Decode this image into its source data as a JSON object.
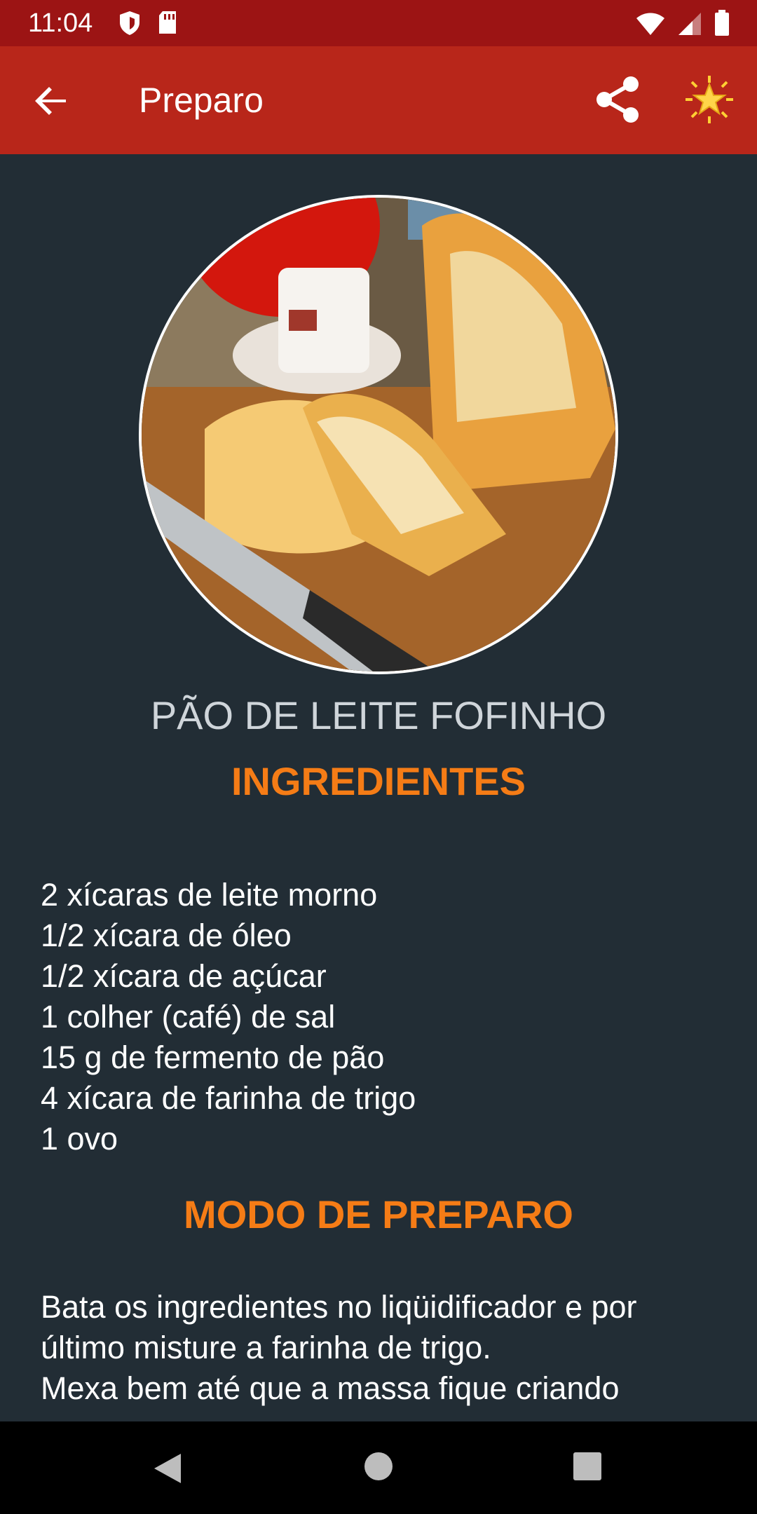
{
  "status_bar": {
    "time": "11:04",
    "icons": [
      "shield-icon",
      "sd-card-icon",
      "wifi-icon",
      "signal-icon",
      "battery-icon"
    ]
  },
  "app_bar": {
    "title": "Preparo",
    "back_icon": "arrow-back-icon",
    "share_icon": "share-icon",
    "favorite_icon": "star-icon"
  },
  "recipe": {
    "name": "PÃO DE LEITE FOFINHO",
    "ingredients_heading": "INGREDIENTES",
    "ingredients": [
      "2 xícaras de leite morno",
      "1/2 xícara de óleo",
      "1/2 xícara de açúcar",
      "1 colher (café) de sal",
      "15 g de fermento de pão",
      "4 xícara de farinha de trigo",
      "1 ovo"
    ],
    "instructions_heading": "MODO DE PREPARO",
    "instructions": [
      "Bata os ingredientes no liqüidificador e por",
      "último misture a farinha de trigo.",
      "Mexa bem até que a massa fique criando"
    ]
  },
  "colors": {
    "status_bar": "#9c1414",
    "app_bar": "#b8261a",
    "background": "#222d35",
    "accent": "#f57c16"
  },
  "nav_bar": {
    "icons": [
      "nav-back-icon",
      "nav-home-icon",
      "nav-recents-icon"
    ]
  }
}
